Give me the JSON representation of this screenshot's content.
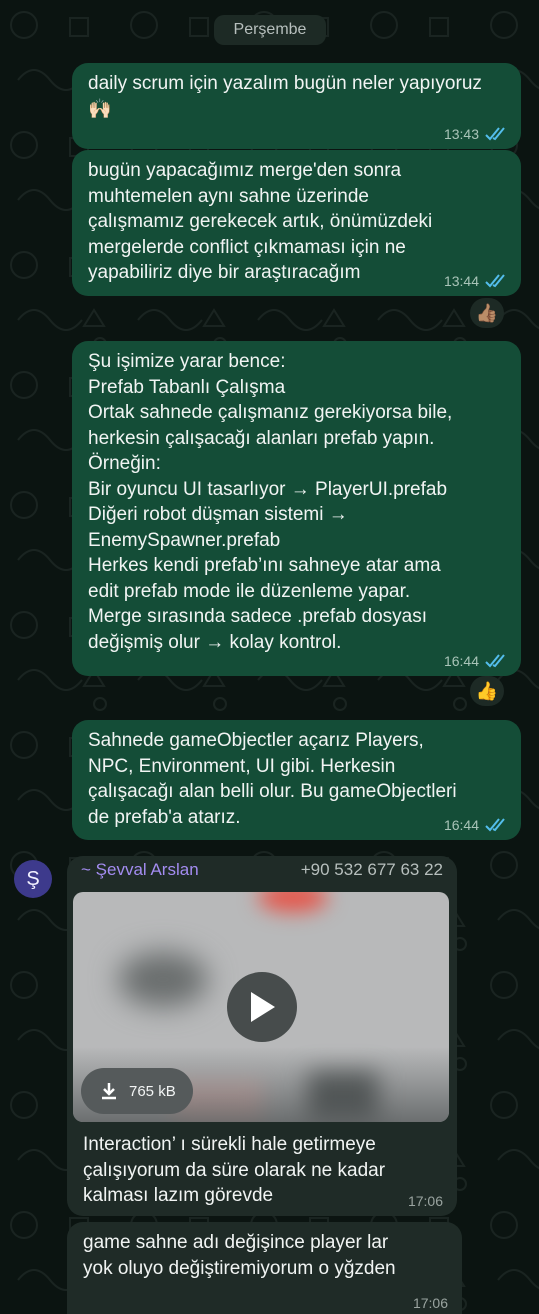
{
  "day_label": "Perşembe",
  "messages": [
    {
      "text": "daily scrum için yazalım bugün neler yapıyoruz🙌🏻",
      "time": "13:43"
    },
    {
      "text": "bugün yapacağımız merge'den sonra\nmuhtemelen aynı sahne üzerinde\nçalışmamız gerekecek artık, önümüzdeki\nmergelerde conflict çıkmaması için ne\nyapabiliriz diye bir araştıracağım",
      "time": "13:44",
      "reaction": "👍🏽"
    },
    {
      "text": "Şu işimize yarar bence:\nPrefab Tabanlı Çalışma\nOrtak sahnede çalışmanız gerekiyorsa bile,\nherkesin çalışacağı alanları prefab yapın.\nÖrneğin:\nBir oyuncu UI tasarlıyor → PlayerUI.prefab\nDiğeri robot düşman sistemi →\nEnemySpawner.prefab\nHerkes kendi prefab’ını sahneye atar ama\nedit prefab mode ile düzenleme yapar.\nMerge sırasında sadece .prefab dosyası\ndeğişmiş olur → kolay kontrol.",
      "time": "16:44",
      "reaction": "👍"
    },
    {
      "text": "Sahnede gameObjectler açarız Players,\nNPC, Environment, UI gibi. Herkesin\nçalışacağı alan belli olur. Bu gameObjectleri\nde prefab'a atarız.",
      "time": "16:44"
    },
    {
      "avatar_letter": "Ş",
      "sender": "~ Şevval Arslan",
      "phone": "+90 532 677 63 22",
      "file_size": "765 kB",
      "text": "Interaction’ ı sürekli hale getirmeye\nçalışıyorum da süre olarak ne kadar\nkalması lazım görevde",
      "time": "17:06"
    },
    {
      "text": "game sahne adı değişince player lar\nyok oluyo değiştiremiyorum o yğzden",
      "time": "17:06"
    }
  ],
  "colors": {
    "outgoing": "#144d37",
    "incoming": "#1f2b27",
    "read_ticks": "#53bdeb",
    "sender": "#a38cf0"
  }
}
